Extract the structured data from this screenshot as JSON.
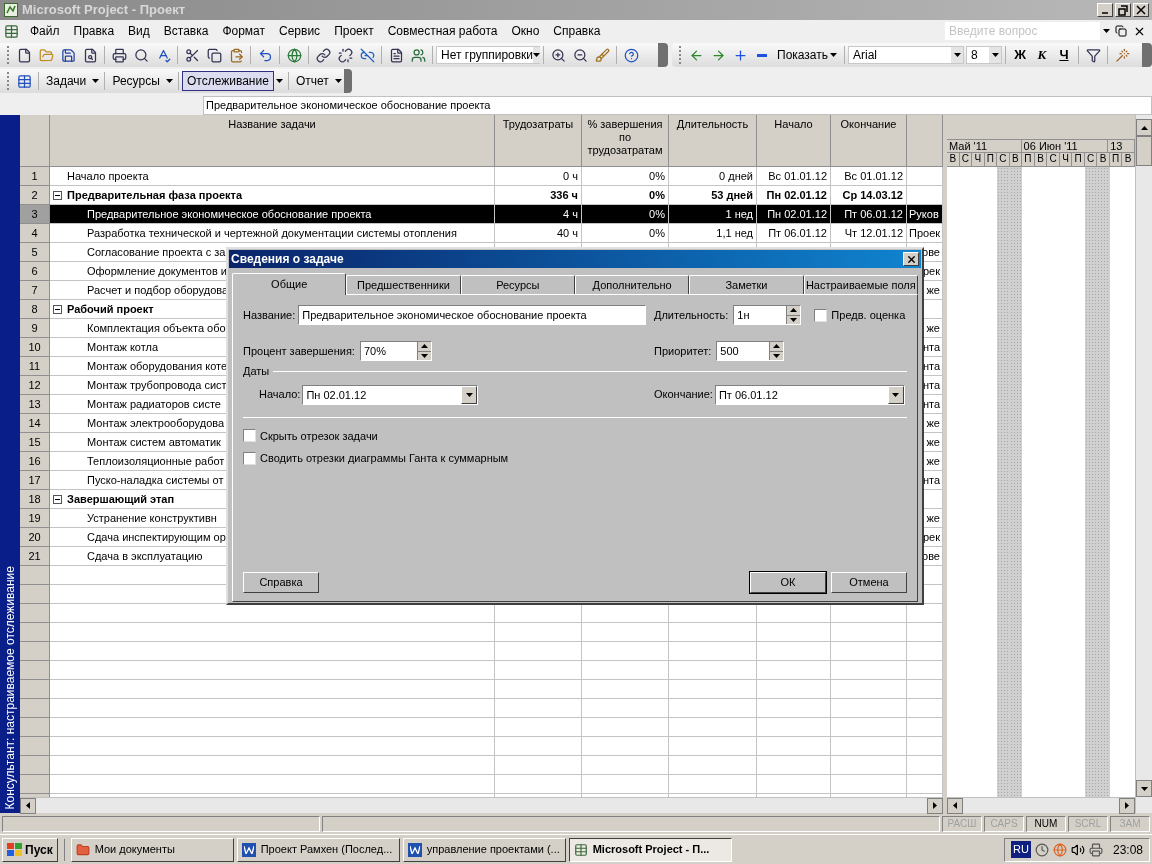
{
  "window": {
    "title": "Microsoft Project - Проект"
  },
  "menu": [
    "Файл",
    "Правка",
    "Вид",
    "Вставка",
    "Формат",
    "Сервис",
    "Проект",
    "Совместная работа",
    "Окно",
    "Справка"
  ],
  "help_box": {
    "placeholder": "Введите вопрос"
  },
  "toolbar": {
    "grouping": "Нет группировки",
    "show": "Показать",
    "font": "Arial",
    "size": "8",
    "format_buttons": [
      {
        "label": "Ж",
        "kind": "bold"
      },
      {
        "label": "К",
        "kind": "italic"
      },
      {
        "label": "Ч",
        "kind": "underline"
      }
    ]
  },
  "views_toolbar": [
    {
      "label": "Задачи",
      "selected": false
    },
    {
      "label": "Ресурсы",
      "selected": false
    },
    {
      "label": "Отслеживание",
      "selected": true
    },
    {
      "label": "Отчет",
      "selected": false
    }
  ],
  "entry_bar": {
    "value": "Предварительное экономическое обоснование проекта"
  },
  "side_label": "Консультант: настраиваемое отслеживание",
  "table": {
    "columns": [
      "Название задачи",
      "Трудозатраты",
      "% завершения по трудозатратам",
      "Длительность",
      "Начало",
      "Окончание"
    ],
    "rows": [
      {
        "id": "1",
        "name": "Начало проекта",
        "work": "0 ч",
        "pct": "0%",
        "duration": "0 дней",
        "start": "Вс 01.01.12",
        "finish": "Вс 01.01.12",
        "selected": false
      },
      {
        "id": "2",
        "name": "Предварительная фаза проекта",
        "work": "336 ч",
        "pct": "0%",
        "duration": "53 дней",
        "start": "Пн 02.01.12",
        "finish": "Ср 14.03.12",
        "selected": false,
        "expanded": true,
        "children": [
          {
            "id": "3",
            "name": "Предварительное экономическое обоснование проекта",
            "work": "4 ч",
            "pct": "0%",
            "duration": "1 нед",
            "start": "Пн 02.01.12",
            "finish": "Пт 06.01.12",
            "resource": "Руков",
            "selected": true
          },
          {
            "id": "4",
            "name": "Разработка технической и чертежной документации системы отопления",
            "work": "40 ч",
            "pct": "0%",
            "duration": "1,1 нед",
            "start": "Пт 06.01.12",
            "finish": "Чт 12.01.12",
            "resource": "Проек",
            "selected": false
          },
          {
            "id": "5",
            "name": "Согласование проекта с за",
            "resource": "ове",
            "selected": false
          },
          {
            "id": "6",
            "name": "Оформление документов и",
            "resource": "рек",
            "selected": false
          },
          {
            "id": "7",
            "name": "Расчет и подбор оборудова",
            "resource": "же",
            "selected": false
          }
        ]
      },
      {
        "id": "8",
        "name": "Рабочий проект",
        "selected": false,
        "expanded": true,
        "children": [
          {
            "id": "9",
            "name": "Комплектация объекта обо",
            "resource": "же",
            "selected": false
          },
          {
            "id": "10",
            "name": "Монтаж котла",
            "resource": "нта",
            "selected": false
          },
          {
            "id": "11",
            "name": "Монтаж оборудования коте",
            "resource": "нта",
            "selected": false
          },
          {
            "id": "12",
            "name": "Монтаж трубопровода сист",
            "resource": "нта",
            "selected": false
          },
          {
            "id": "13",
            "name": "Монтаж радиаторов систе",
            "resource": "нта",
            "selected": false
          },
          {
            "id": "14",
            "name": "Монтаж электрооборудова",
            "resource": "же",
            "selected": false
          },
          {
            "id": "15",
            "name": "Монтаж систем автоматик",
            "resource": "же",
            "selected": false
          },
          {
            "id": "16",
            "name": "Теплоизоляционные работ",
            "resource": "же",
            "selected": false
          },
          {
            "id": "17",
            "name": "Пуско-наладка системы от",
            "resource": "нта",
            "selected": false
          }
        ]
      },
      {
        "id": "18",
        "name": "Завершающий этап",
        "selected": false,
        "expanded": true,
        "children": [
          {
            "id": "19",
            "name": "Устранение конструктивн",
            "resource": "же",
            "selected": false
          },
          {
            "id": "20",
            "name": "Сдача инспектирующим ор",
            "resource": "рек",
            "selected": false
          },
          {
            "id": "21",
            "name": "Сдача в эксплуатацию",
            "resource": "ове",
            "selected": false
          }
        ]
      }
    ]
  },
  "gantt": {
    "weeks": [
      "Май '11",
      "06 Июн '11",
      "13"
    ],
    "days": [
      {
        "label": "В",
        "weekend": false
      },
      {
        "label": "С",
        "weekend": false
      },
      {
        "label": "Ч",
        "weekend": false
      },
      {
        "label": "П",
        "weekend": false
      },
      {
        "label": "С",
        "weekend": true
      },
      {
        "label": "В",
        "weekend": true
      },
      {
        "label": "П",
        "weekend": false
      },
      {
        "label": "В",
        "weekend": false
      },
      {
        "label": "С",
        "weekend": false
      },
      {
        "label": "Ч",
        "weekend": false
      },
      {
        "label": "П",
        "weekend": false
      },
      {
        "label": "С",
        "weekend": true
      },
      {
        "label": "В",
        "weekend": true
      },
      {
        "label": "П",
        "weekend": false
      },
      {
        "label": "В",
        "weekend": false
      }
    ]
  },
  "dialog": {
    "title": "Сведения о задаче",
    "tabs": [
      {
        "label": "Общие",
        "selected": true
      },
      {
        "label": "Предшественники",
        "selected": false
      },
      {
        "label": "Ресурсы",
        "selected": false
      },
      {
        "label": "Дополнительно",
        "selected": false
      },
      {
        "label": "Заметки",
        "selected": false
      },
      {
        "label": "Настраиваемые поля",
        "selected": false
      }
    ],
    "name": {
      "label": "Название:",
      "value": "Предварительное экономическое обоснование проекта"
    },
    "duration": {
      "label": "Длительность:",
      "value": "1н"
    },
    "estimated": {
      "label": "Предв. оценка",
      "checked": false
    },
    "percent": {
      "label": "Процент завершения:",
      "value": "70%"
    },
    "priority": {
      "label": "Приоритет:",
      "value": "500"
    },
    "dates_group": "Даты",
    "start": {
      "label": "Начало:",
      "value": "Пн 02.01.12"
    },
    "finish": {
      "label": "Окончание:",
      "value": "Пт 06.01.12"
    },
    "checkboxes": [
      {
        "label": "Скрыть отрезок задачи",
        "checked": false
      },
      {
        "label": "Сводить отрезки диаграммы Ганта к суммарным",
        "checked": false
      }
    ],
    "buttons": [
      {
        "label": "Справка",
        "default": false
      },
      {
        "label": "ОК",
        "default": true
      },
      {
        "label": "Отмена",
        "default": false
      }
    ]
  },
  "status_bar": [
    {
      "label": "РАСШ",
      "on": false
    },
    {
      "label": "CAPS",
      "on": false
    },
    {
      "label": "NUM",
      "on": true
    },
    {
      "label": "SCRL",
      "on": false
    },
    {
      "label": "ЗАМ",
      "on": false
    }
  ],
  "taskbar": {
    "start": "Пуск",
    "items": [
      {
        "label": "Мои документы",
        "kind": "folder",
        "selected": false
      },
      {
        "label": "Проект Рамхен (Послед...",
        "kind": "word",
        "selected": false
      },
      {
        "label": "управление проектами (...",
        "kind": "word",
        "selected": false
      },
      {
        "label": "Microsoft Project - П...",
        "kind": "project",
        "selected": true
      }
    ],
    "lang": "RU",
    "time": "23:08"
  }
}
